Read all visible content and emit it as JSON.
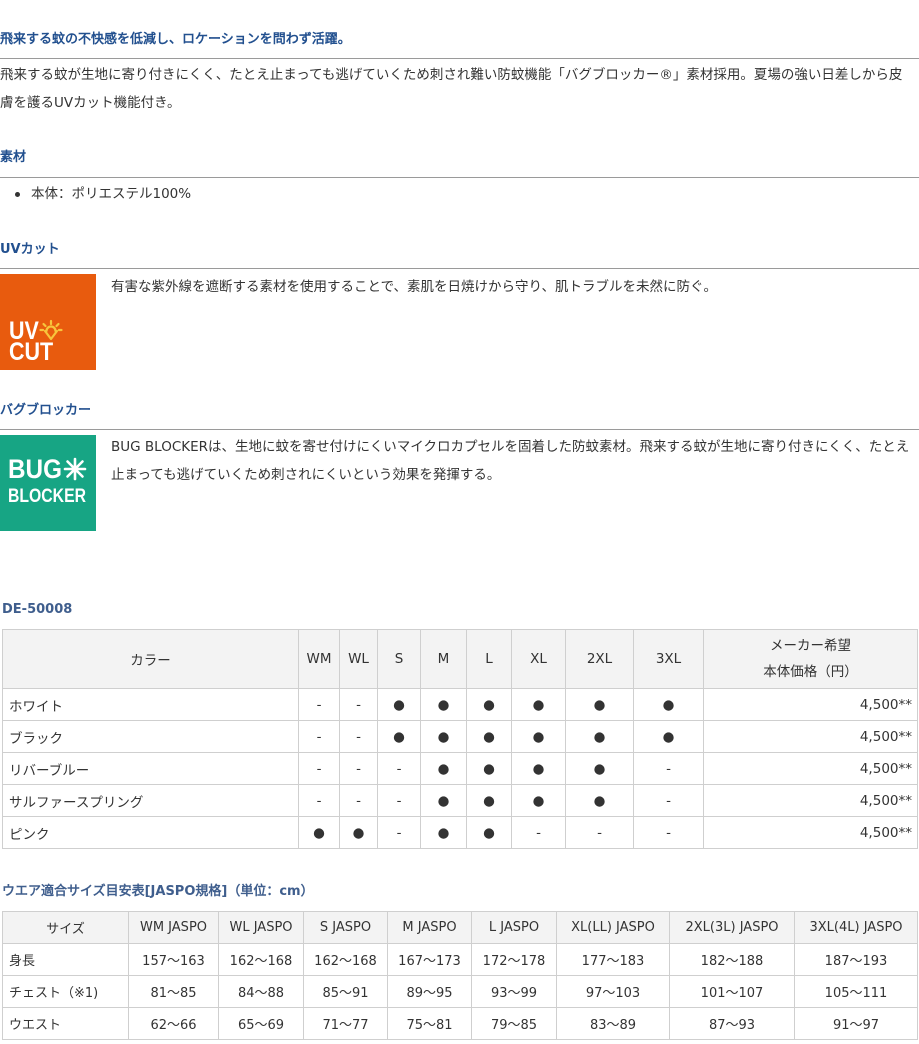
{
  "intro": {
    "heading": "飛来する蚊の不快感を低減し、ロケーションを問わず活躍。",
    "body": "飛来する蚊が生地に寄り付きにくく、たとえ止まっても逃げていくため刺され難い防蚊機能「バグブロッカー®」素材採用。夏場の強い日差しから皮膚を護るUVカット機能付き。"
  },
  "material": {
    "heading": "素材",
    "items": [
      "本体：ポリエステル100%"
    ]
  },
  "uv_cut": {
    "heading": "UVカット",
    "logo": {
      "line1": "UV",
      "line2": "CUT",
      "icon": "sun-icon",
      "color": "#e85b0e",
      "icon_color": "#f7c53c"
    },
    "description": "有害な紫外線を遮断する素材を使用することで、素肌を日焼けから守り、肌トラブルを未然に防ぐ。"
  },
  "bug_blocker": {
    "heading": "バグブロッカー",
    "logo": {
      "line1": "BUG",
      "line2": "BLOCKER",
      "icon": "starburst-icon",
      "color": "#17a584"
    },
    "description": "BUG BLOCKERは、生地に蚊を寄せ付けにくいマイクロカプセルを固着した防蚊素材。飛来する蚊が生地に寄り付きにくく、たとえ止まっても逃げていくため刺されにくいという効果を発揮する。"
  },
  "product_table": {
    "model": "DE-50008",
    "color_header": "カラー",
    "sizes": [
      "WM",
      "WL",
      "S",
      "M",
      "L",
      "XL",
      "2XL",
      "3XL"
    ],
    "price_header": [
      "メーカー希望",
      "本体価格（円）"
    ],
    "rows": [
      {
        "color": "ホワイト",
        "availability": [
          "-",
          "-",
          "●",
          "●",
          "●",
          "●",
          "●",
          "●"
        ],
        "price": "4,500**"
      },
      {
        "color": "ブラック",
        "availability": [
          "-",
          "-",
          "●",
          "●",
          "●",
          "●",
          "●",
          "●"
        ],
        "price": "4,500**"
      },
      {
        "color": "リバーブルー",
        "availability": [
          "-",
          "-",
          "-",
          "●",
          "●",
          "●",
          "●",
          "-"
        ],
        "price": "4,500**"
      },
      {
        "color": "サルファースプリング",
        "availability": [
          "-",
          "-",
          "-",
          "●",
          "●",
          "●",
          "●",
          "-"
        ],
        "price": "4,500**"
      },
      {
        "color": "ピンク",
        "availability": [
          "●",
          "●",
          "-",
          "●",
          "●",
          "-",
          "-",
          "-"
        ],
        "price": "4,500**"
      }
    ]
  },
  "size_chart": {
    "heading": "ウエア適合サイズ目安表[JASPO規格]（単位：cm）",
    "headers": [
      "サイズ",
      "WM JASPO",
      "WL JASPO",
      "S JASPO",
      "M JASPO",
      "L JASPO",
      "XL(LL) JASPO",
      "2XL(3L) JASPO",
      "3XL(4L) JASPO"
    ],
    "rows": [
      {
        "label": "身長",
        "values": [
          "157～163",
          "162～168",
          "162～168",
          "167～173",
          "172～178",
          "177～183",
          "182～188",
          "187～193"
        ]
      },
      {
        "label": "チェスト（※1)",
        "values": [
          "81～85",
          "84～88",
          "85～91",
          "89～95",
          "93～99",
          "97～103",
          "101～107",
          "105～111"
        ]
      },
      {
        "label": "ウエスト",
        "values": [
          "62～66",
          "65～69",
          "71～77",
          "75～81",
          "79～85",
          "83～89",
          "87～93",
          "91～97"
        ]
      }
    ]
  },
  "theme": {
    "heading_color": "#22508f",
    "subheading_color": "#3f5e8d",
    "table_header_bg": "#f3f3f3",
    "table_border": "#cfcfcf"
  }
}
